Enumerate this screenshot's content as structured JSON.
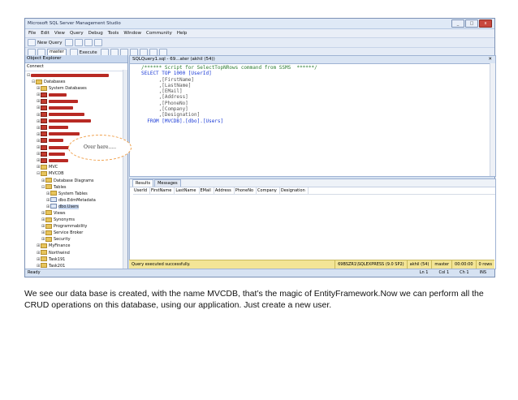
{
  "window": {
    "title": "Microsoft SQL Server Management Studio",
    "buttons": [
      "_",
      "□",
      "x"
    ]
  },
  "menu": [
    "File",
    "Edit",
    "View",
    "Query",
    "Debug",
    "Tools",
    "Window",
    "Community",
    "Help"
  ],
  "toolbar": {
    "new_query": "New Query",
    "database": "master",
    "execute": "Execute"
  },
  "object_explorer": {
    "title": "Object Explorer",
    "connect": "Connect",
    "items": {
      "databases": "Databases",
      "system_databases": "System Databases",
      "mvc": "MVC",
      "mvcdb": "MVCDB",
      "db_diagrams": "Database Diagrams",
      "tables": "Tables",
      "system_tables": "System Tables",
      "edm_metadata": "dbo.EdmMetadata",
      "users": "dbo.Users",
      "views": "Views",
      "synonyms": "Synonyms",
      "programmability": "Programmability",
      "service_broker": "Service Broker",
      "security": "Security",
      "myfinance": "MyFinance",
      "northwind": "Northwind",
      "task191": "Task191",
      "task201": "Task201"
    }
  },
  "editor": {
    "tab": "SQLQuery1.sql - 69...ater (akhil (54))",
    "lines": [
      "/****** Script for SelectTopNRows command from SSMS  ******/",
      "SELECT TOP 1000 [UserId]",
      "      ,[FirstName]",
      "      ,[LastName]",
      "      ,[EMail]",
      "      ,[Address]",
      "      ,[PhoneNo]",
      "      ,[Company]",
      "      ,[Designation]",
      "  FROM [MVCDB].[dbo].[Users]"
    ]
  },
  "results": {
    "tabs": [
      "Results",
      "Messages"
    ],
    "columns": [
      "UserId",
      "FirstName",
      "LastName",
      "EMail",
      "Address",
      "PhoneNo",
      "Company",
      "Designation"
    ],
    "status": "Query executed successfully.",
    "segments": [
      "69BSZR1\\SQLEXPRESS (9.0 SP2)",
      "akhil (54)",
      "master",
      "00:00:00",
      "0 rows"
    ]
  },
  "statusbar": {
    "ready": "Ready",
    "ln": "Ln 1",
    "col": "Col 1",
    "ch": "Ch 1",
    "ins": "INS"
  },
  "callout": "Over here.....",
  "caption": "We see our data base is created, with the name MVCDB, that’s the magic of EntityFramework.Now we can perform all the CRUD operations on this database, using our application. Just create a new user."
}
